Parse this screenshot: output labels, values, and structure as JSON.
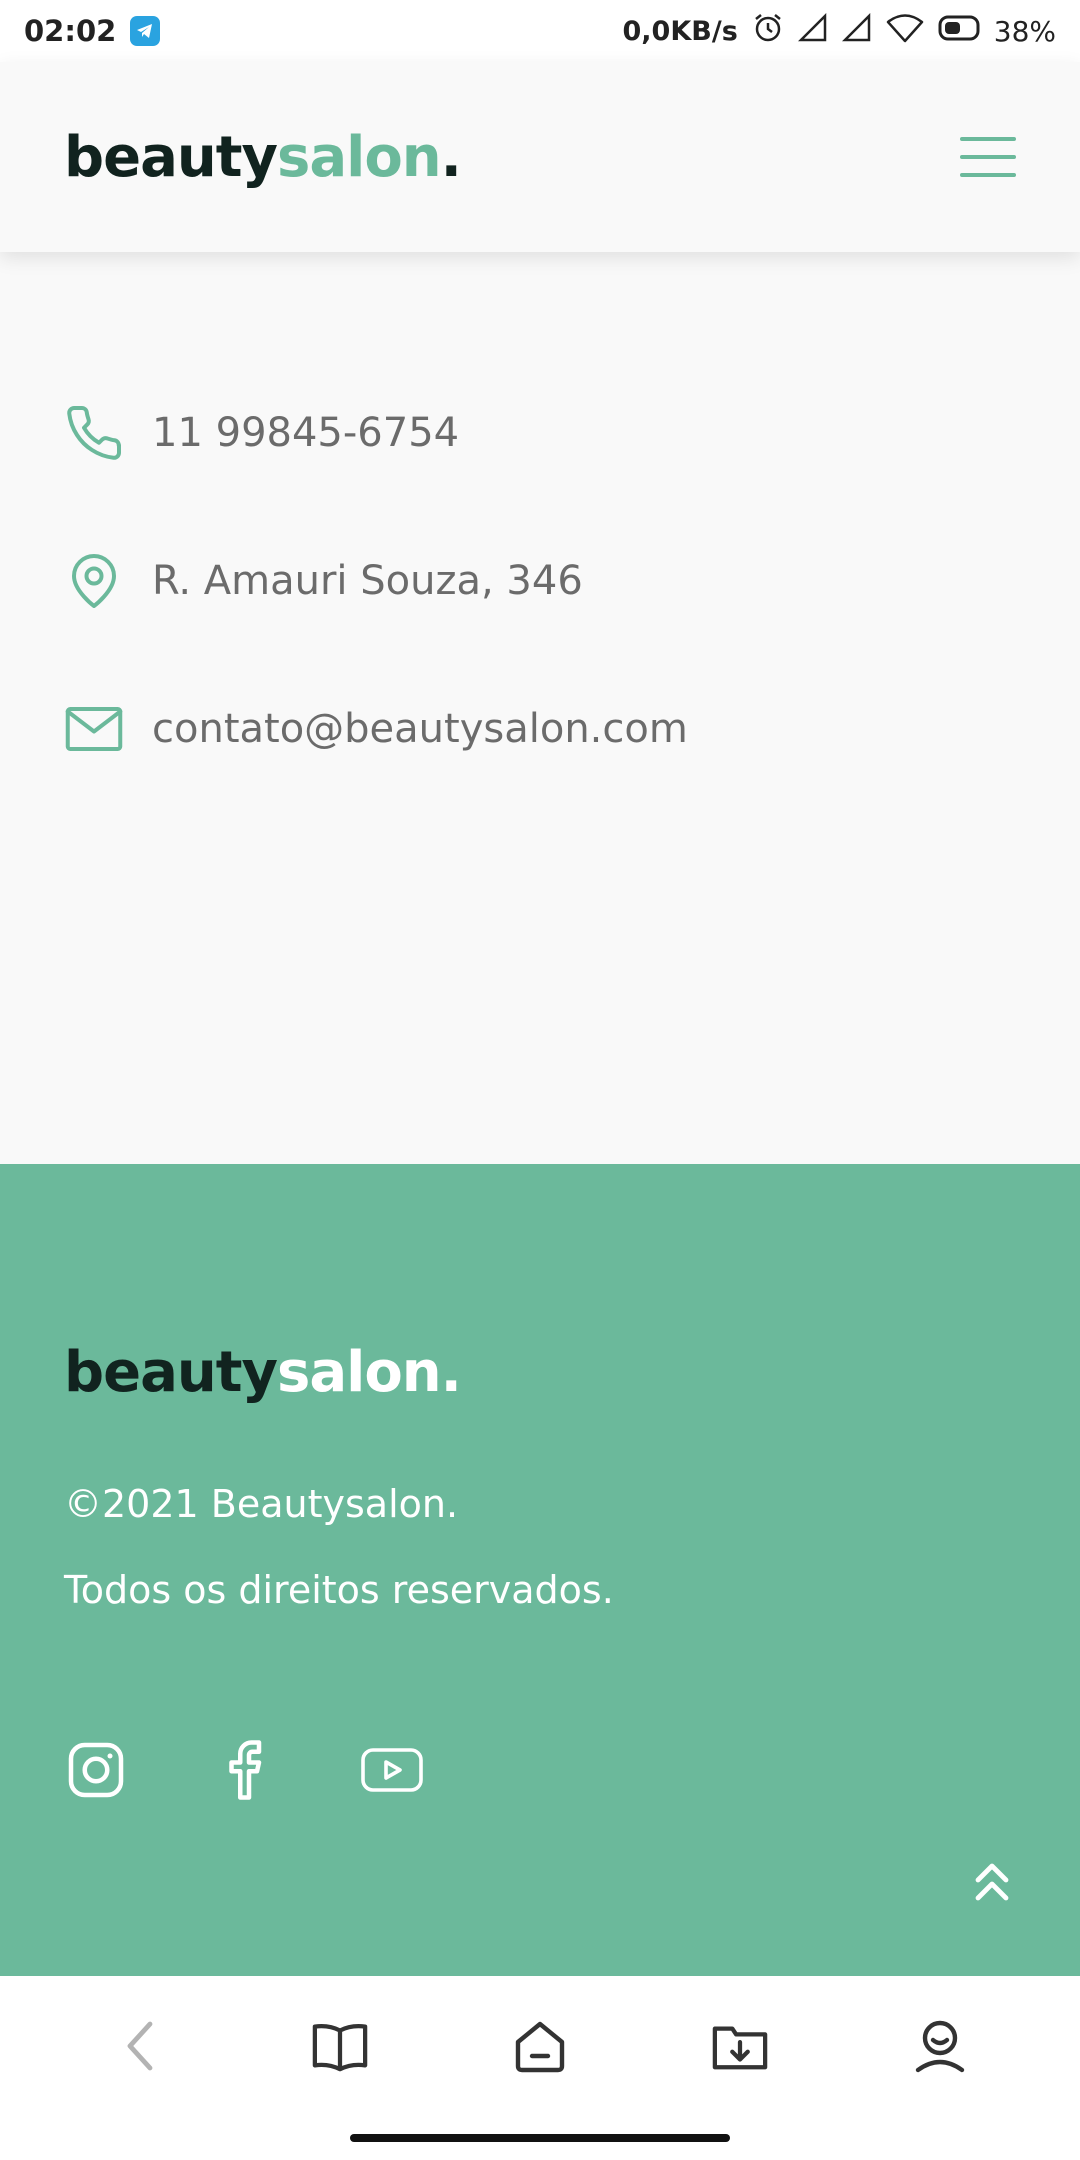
{
  "status_bar": {
    "time": "02:02",
    "network_speed": "0,0KB/s",
    "battery": "38%",
    "icons": [
      "telegram-icon",
      "alarm-icon",
      "signal-icon",
      "signal-icon",
      "wifi-icon",
      "battery-icon"
    ]
  },
  "header": {
    "logo_part1": "beauty",
    "logo_part2": "salon",
    "logo_dot": ".",
    "menu_icon": "hamburger-icon"
  },
  "contact": {
    "items": [
      {
        "icon": "phone-icon",
        "text": "11 99845-6754"
      },
      {
        "icon": "location-pin-icon",
        "text": "R. Amauri Souza, 346"
      },
      {
        "icon": "mail-icon",
        "text": "contato@beautysalon.com"
      }
    ]
  },
  "footer": {
    "logo_part1": "beauty",
    "logo_part2": "salon",
    "logo_dot": ".",
    "copyright": "©2021 Beautysalon.",
    "rights": "Todos os direitos reservados.",
    "socials": [
      "instagram-icon",
      "facebook-icon",
      "youtube-icon"
    ],
    "back_to_top_icon": "double-chevron-up-icon"
  },
  "browser_nav": {
    "icons": [
      "back-icon",
      "bookmarks-icon",
      "home-icon",
      "downloads-icon",
      "profile-icon"
    ]
  },
  "colors": {
    "accent": "#6bb99b",
    "dark": "#11231f",
    "text_muted": "#6b6b6b",
    "background": "#f9f9f9"
  }
}
